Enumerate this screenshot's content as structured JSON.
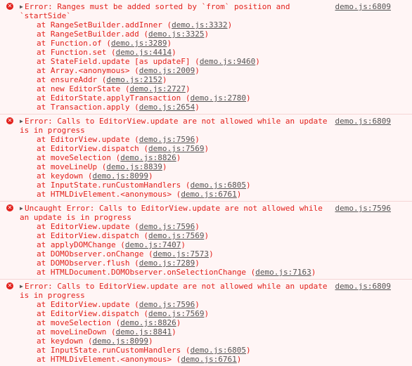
{
  "entries": [
    {
      "message_line1": "Error: Ranges must be added sorted by `from` position and",
      "message_line2": "`startSide`",
      "source": "demo.js:6809",
      "frames": [
        {
          "fn": "RangeSetBuilder.addInner",
          "loc": "demo.js:3332"
        },
        {
          "fn": "RangeSetBuilder.add",
          "loc": "demo.js:3325"
        },
        {
          "fn": "Function.of",
          "loc": "demo.js:3289"
        },
        {
          "fn": "Function.set",
          "loc": "demo.js:4414"
        },
        {
          "fn": "StateField.update [as updateF]",
          "loc": "demo.js:9460"
        },
        {
          "fn": "Array.<anonymous>",
          "loc": "demo.js:2009"
        },
        {
          "fn": "ensureAddr",
          "loc": "demo.js:2152"
        },
        {
          "fn": "new EditorState",
          "loc": "demo.js:2727"
        },
        {
          "fn": "EditorState.applyTransaction",
          "loc": "demo.js:2780"
        },
        {
          "fn": "Transaction.apply",
          "loc": "demo.js:2654"
        }
      ]
    },
    {
      "message_line1": "Error: Calls to EditorView.update are not allowed while an update",
      "message_line2": "is in progress",
      "source": "demo.js:6809",
      "frames": [
        {
          "fn": "EditorView.update",
          "loc": "demo.js:7596"
        },
        {
          "fn": "EditorView.dispatch",
          "loc": "demo.js:7569"
        },
        {
          "fn": "moveSelection",
          "loc": "demo.js:8826"
        },
        {
          "fn": "moveLineUp",
          "loc": "demo.js:8839"
        },
        {
          "fn": "keydown",
          "loc": "demo.js:8099"
        },
        {
          "fn": "InputState.runCustomHandlers",
          "loc": "demo.js:6805"
        },
        {
          "fn": "HTMLDivElement.<anonymous>",
          "loc": "demo.js:6761"
        }
      ]
    },
    {
      "message_line1": "Uncaught Error: Calls to EditorView.update are not allowed while",
      "message_line2": "an update is in progress",
      "source": "demo.js:7596",
      "frames": [
        {
          "fn": "EditorView.update",
          "loc": "demo.js:7596"
        },
        {
          "fn": "EditorView.dispatch",
          "loc": "demo.js:7569"
        },
        {
          "fn": "applyDOMChange",
          "loc": "demo.js:7407"
        },
        {
          "fn": "DOMObserver.onChange",
          "loc": "demo.js:7573"
        },
        {
          "fn": "DOMObserver.flush",
          "loc": "demo.js:7289"
        },
        {
          "fn": "HTMLDocument.DOMObserver.onSelectionChange",
          "loc": "demo.js:7163"
        }
      ]
    },
    {
      "message_line1": "Error: Calls to EditorView.update are not allowed while an update",
      "message_line2": "is in progress",
      "source": "demo.js:6809",
      "frames": [
        {
          "fn": "EditorView.update",
          "loc": "demo.js:7596"
        },
        {
          "fn": "EditorView.dispatch",
          "loc": "demo.js:7569"
        },
        {
          "fn": "moveSelection",
          "loc": "demo.js:8826"
        },
        {
          "fn": "moveLineDown",
          "loc": "demo.js:8841"
        },
        {
          "fn": "keydown",
          "loc": "demo.js:8099"
        },
        {
          "fn": "InputState.runCustomHandlers",
          "loc": "demo.js:6805"
        },
        {
          "fn": "HTMLDivElement.<anonymous>",
          "loc": "demo.js:6761"
        }
      ]
    }
  ],
  "labels": {
    "at": "at",
    "expand_icon": "triangle-right-icon",
    "error_icon": "error-circle-icon"
  },
  "colors": {
    "error_text": "#e2211c",
    "background": "#fff5f5",
    "link": "#545454"
  }
}
